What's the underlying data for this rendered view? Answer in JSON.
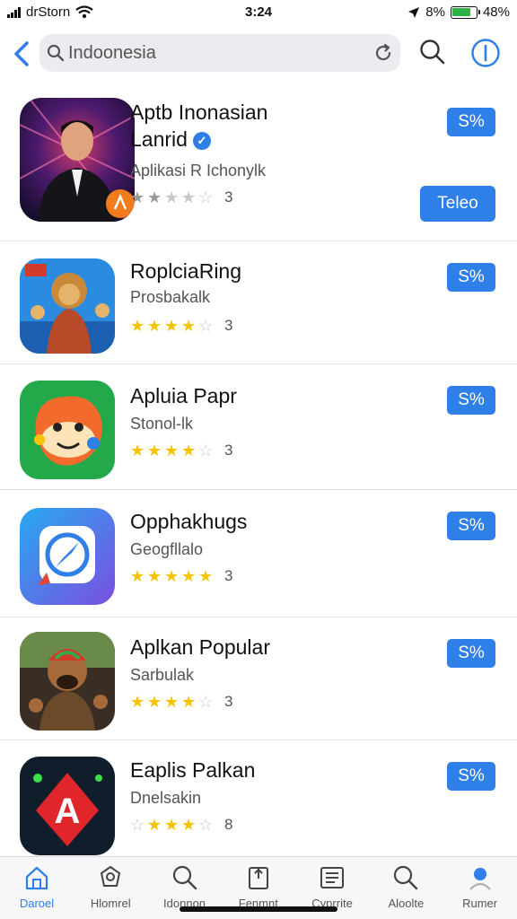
{
  "status_bar": {
    "carrier": "drStorn",
    "time": "3:24",
    "location_percent": "8%",
    "battery_percent": "48%"
  },
  "search": {
    "value": "Indoonesia"
  },
  "apps": [
    {
      "title_line1": "Aptb Inonasian",
      "title_line2": "Lanrid",
      "subtitle": "Aplikasi R Ichonylk",
      "rating": 2,
      "rating_count": "3",
      "price": "S%",
      "action": "Teleo"
    },
    {
      "title": "RoplciaRing",
      "subtitle": "Prosbakalk",
      "rating": 4,
      "rating_count": "3",
      "price": "S%"
    },
    {
      "title": "Apluia Papr",
      "subtitle": "Stonol-lk",
      "rating": 4,
      "rating_count": "3",
      "price": "S%"
    },
    {
      "title": "Opphakhugs",
      "subtitle": "Geogfllalo",
      "rating": 5,
      "rating_count": "3",
      "price": "S%"
    },
    {
      "title": "Aplkan Popular",
      "subtitle": "Sarbulak",
      "rating": 4,
      "rating_count": "3",
      "price": "S%"
    },
    {
      "title": "Eaplis Palkan",
      "subtitle": "Dnelsakin",
      "rating": 3,
      "rating_count": "8",
      "price": "S%"
    }
  ],
  "tabs": [
    {
      "label": "Daroel",
      "icon": "home-icon"
    },
    {
      "label": "Hlomrel",
      "icon": "games-icon"
    },
    {
      "label": "Idonnon",
      "icon": "search-icon"
    },
    {
      "label": "Fenmnt",
      "icon": "apps-icon"
    },
    {
      "label": "Cyprrite",
      "icon": "news-icon"
    },
    {
      "label": "Aloolte",
      "icon": "search-icon"
    },
    {
      "label": "Rumer",
      "icon": "profile-icon"
    }
  ],
  "colors": {
    "accent": "#2f7fe8",
    "star": "#f5c400",
    "battery": "#2bb34a"
  }
}
